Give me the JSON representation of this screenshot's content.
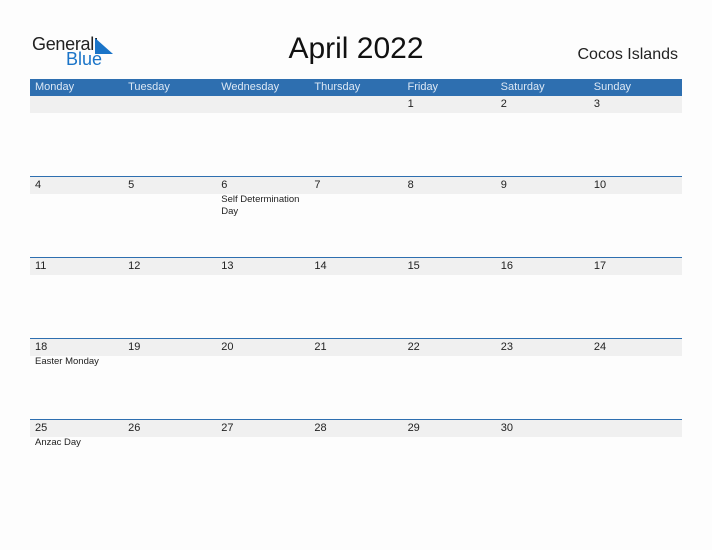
{
  "logo": {
    "text_general": "General",
    "text_blue": "Blue",
    "accent": "#1a74c8"
  },
  "title": "April 2022",
  "region": "Cocos Islands",
  "colors": {
    "header_bg": "#2e6fb0",
    "date_band": "#f0f0f0"
  },
  "weekdays": [
    "Monday",
    "Tuesday",
    "Wednesday",
    "Thursday",
    "Friday",
    "Saturday",
    "Sunday"
  ],
  "weeks": [
    [
      {
        "d": ""
      },
      {
        "d": ""
      },
      {
        "d": ""
      },
      {
        "d": ""
      },
      {
        "d": "1"
      },
      {
        "d": "2"
      },
      {
        "d": "3"
      }
    ],
    [
      {
        "d": "4"
      },
      {
        "d": "5"
      },
      {
        "d": "6",
        "event": "Self Determination Day"
      },
      {
        "d": "7"
      },
      {
        "d": "8"
      },
      {
        "d": "9"
      },
      {
        "d": "10"
      }
    ],
    [
      {
        "d": "11"
      },
      {
        "d": "12"
      },
      {
        "d": "13"
      },
      {
        "d": "14"
      },
      {
        "d": "15"
      },
      {
        "d": "16"
      },
      {
        "d": "17"
      }
    ],
    [
      {
        "d": "18",
        "event": "Easter Monday"
      },
      {
        "d": "19"
      },
      {
        "d": "20"
      },
      {
        "d": "21"
      },
      {
        "d": "22"
      },
      {
        "d": "23"
      },
      {
        "d": "24"
      }
    ],
    [
      {
        "d": "25",
        "event": "Anzac Day"
      },
      {
        "d": "26"
      },
      {
        "d": "27"
      },
      {
        "d": "28"
      },
      {
        "d": "29"
      },
      {
        "d": "30"
      },
      {
        "d": ""
      }
    ]
  ]
}
